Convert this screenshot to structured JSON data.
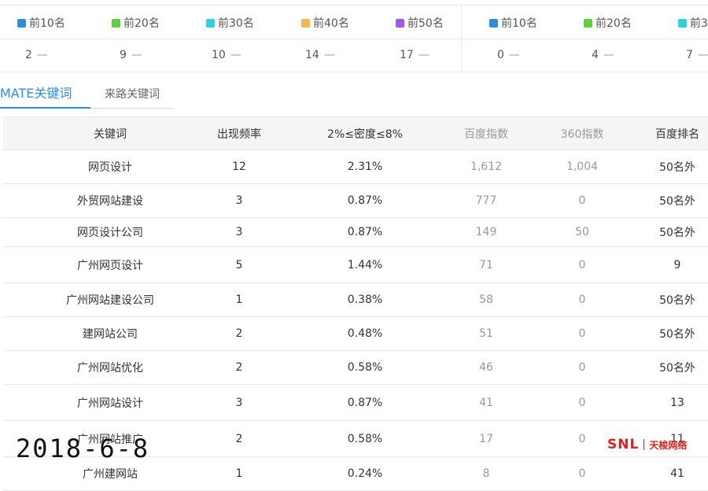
{
  "rank_panel": {
    "legend": [
      {
        "label": "前10名",
        "color": "#2e8fd8"
      },
      {
        "label": "前20名",
        "color": "#5fcf3c"
      },
      {
        "label": "前30名",
        "color": "#2fd0e0"
      },
      {
        "label": "前40名",
        "color": "#f2b84b"
      },
      {
        "label": "前50名",
        "color": "#a258e8"
      },
      {
        "label": "前10名",
        "color": "#2e8fd8"
      },
      {
        "label": "前20名",
        "color": "#5fcf3c"
      },
      {
        "label": "前3",
        "color": "#2fd0e0"
      }
    ],
    "values": [
      "2",
      "9",
      "10",
      "14",
      "17",
      "0",
      "4",
      "7"
    ],
    "trend_symbol": "—"
  },
  "tabs": {
    "active": "MATE关键词",
    "inactive": "来路关键词"
  },
  "table": {
    "headers": [
      "关键词",
      "出现频率",
      "2%≤密度≤8%",
      "百度指数",
      "360指数",
      "百度排名"
    ],
    "rows": [
      [
        "网页设计",
        "12",
        "2.31%",
        "1,612",
        "1,004",
        "50名外"
      ],
      [
        "外贸网站建设",
        "3",
        "0.87%",
        "777",
        "0",
        "50名外"
      ],
      [
        "网页设计公司",
        "3",
        "0.87%",
        "149",
        "50",
        "50名外"
      ],
      [
        "广州网页设计",
        "5",
        "1.44%",
        "71",
        "0",
        "9"
      ],
      [
        "广州网站建设公司",
        "1",
        "0.38%",
        "58",
        "0",
        "50名外"
      ],
      [
        "建网站公司",
        "2",
        "0.48%",
        "51",
        "0",
        "50名外"
      ],
      [
        "广州网站优化",
        "2",
        "0.58%",
        "46",
        "0",
        "50名外"
      ],
      [
        "广州网站设计",
        "3",
        "0.87%",
        "41",
        "0",
        "13"
      ],
      [
        "广州网站推广",
        "2",
        "0.58%",
        "17",
        "0",
        "11"
      ],
      [
        "广州建网站",
        "1",
        "0.24%",
        "8",
        "0",
        "41"
      ]
    ]
  },
  "overlay": {
    "date": "2018-6-8",
    "logo_en": "SNL",
    "logo_cn": "天梭网络"
  }
}
